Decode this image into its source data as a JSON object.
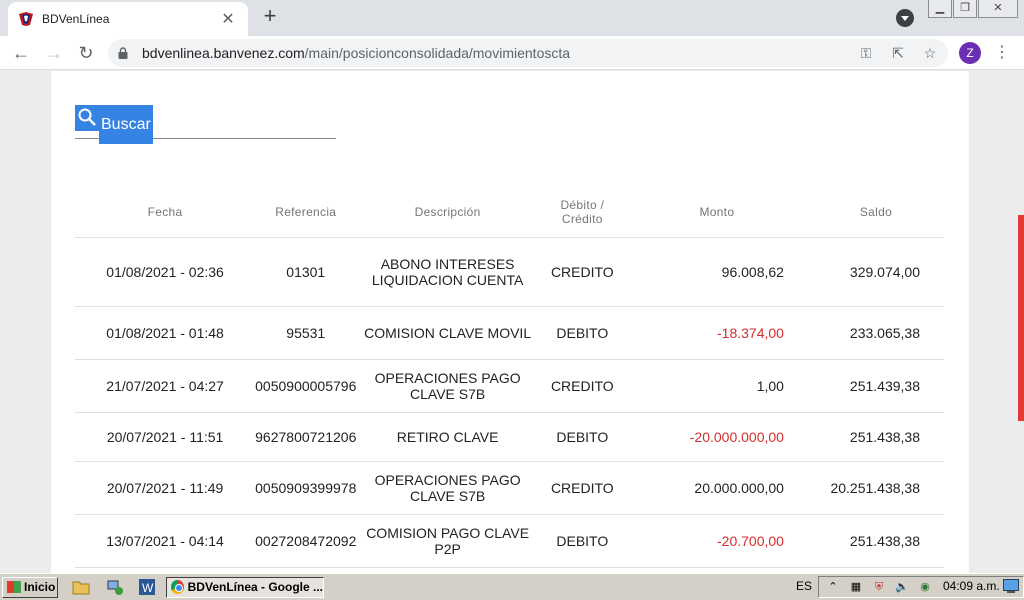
{
  "browser": {
    "tab_title": "BDVenLínea",
    "tab_close": "✕",
    "new_tab": "+",
    "url_host": "bdvenlinea.banvenez.com",
    "url_path": "/main/posicionconsolidada/movimientoscta",
    "profile_initial": "Z",
    "window_controls": [
      "minimize",
      "restore",
      "close"
    ]
  },
  "search": {
    "label": "Buscar"
  },
  "table": {
    "headers": [
      "Fecha",
      "Referencia",
      "Descripción",
      "Débito / Crédito",
      "Monto",
      "Saldo"
    ],
    "rows": [
      {
        "fecha": "01/08/2021 - 02:36",
        "referencia": "01301",
        "descripcion": "ABONO INTERESES LIQUIDACION CUENTA",
        "tipo": "CREDITO",
        "monto": "96.008,62",
        "saldo": "329.074,00",
        "negative": false
      },
      {
        "fecha": "01/08/2021 - 01:48",
        "referencia": "95531",
        "descripcion": "COMISION CLAVE MOVIL",
        "tipo": "DEBITO",
        "monto": "-18.374,00",
        "saldo": "233.065,38",
        "negative": true
      },
      {
        "fecha": "21/07/2021 - 04:27",
        "referencia": "0050900005796",
        "descripcion": "OPERACIONES PAGO CLAVE S7B",
        "tipo": "CREDITO",
        "monto": "1,00",
        "saldo": "251.439,38",
        "negative": false
      },
      {
        "fecha": "20/07/2021 - 11:51",
        "referencia": "9627800721206",
        "descripcion": "RETIRO CLAVE",
        "tipo": "DEBITO",
        "monto": "-20.000.000,00",
        "saldo": "251.438,38",
        "negative": true
      },
      {
        "fecha": "20/07/2021 - 11:49",
        "referencia": "0050909399978",
        "descripcion": "OPERACIONES PAGO CLAVE S7B",
        "tipo": "CREDITO",
        "monto": "20.000.000,00",
        "saldo": "20.251.438,38",
        "negative": false
      },
      {
        "fecha": "13/07/2021 - 04:14",
        "referencia": "0027208472092",
        "descripcion": "COMISION PAGO CLAVE P2P",
        "tipo": "DEBITO",
        "monto": "-20.700,00",
        "saldo": "251.438,38",
        "negative": true
      }
    ]
  },
  "colors": {
    "negative": "#d32f2f",
    "selection": "#3584e4",
    "scroll_indicator": "#e53935"
  },
  "taskbar": {
    "start_label": "Inicio",
    "task_label": "BDVenLínea - Google ...",
    "language": "ES",
    "clock": "04:09 a.m."
  }
}
